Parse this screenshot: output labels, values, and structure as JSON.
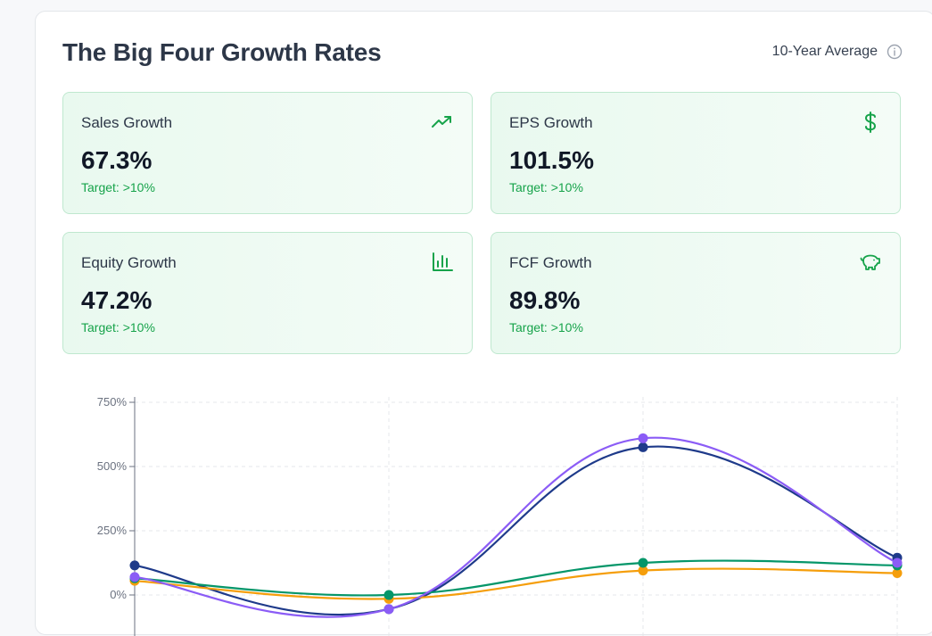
{
  "header": {
    "title": "The Big Four Growth Rates",
    "period_label": "10-Year Average"
  },
  "metrics": [
    {
      "label": "Sales Growth",
      "value": "67.3%",
      "target": "Target: >10%",
      "icon": "trending-up-icon"
    },
    {
      "label": "EPS Growth",
      "value": "101.5%",
      "target": "Target: >10%",
      "icon": "dollar-icon"
    },
    {
      "label": "Equity Growth",
      "value": "47.2%",
      "target": "Target: >10%",
      "icon": "bar-chart-icon"
    },
    {
      "label": "FCF Growth",
      "value": "89.8%",
      "target": "Target: >10%",
      "icon": "piggy-bank-icon"
    }
  ],
  "colors": {
    "accent_green": "#16a34a",
    "card_border": "#bfe8cf"
  },
  "chart_data": {
    "type": "line",
    "x": [
      0,
      1,
      2,
      3
    ],
    "ylim": [
      -150,
      750
    ],
    "yticks": [
      0,
      250,
      500,
      750
    ],
    "ytick_labels": [
      "0%",
      "250%",
      "500%",
      "750%"
    ],
    "grid": true,
    "series": [
      {
        "color": "#1e3a8a",
        "values": [
          115,
          -55,
          575,
          145
        ]
      },
      {
        "color": "#f59e0b",
        "values": [
          55,
          -15,
          95,
          85
        ]
      },
      {
        "color": "#059669",
        "values": [
          65,
          0,
          125,
          115
        ]
      },
      {
        "color": "#8b5cf6",
        "values": [
          70,
          -55,
          610,
          125
        ]
      }
    ]
  }
}
